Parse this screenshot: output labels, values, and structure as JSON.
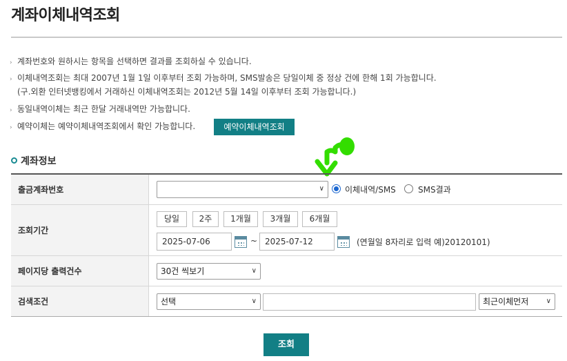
{
  "page": {
    "title": "계좌이체내역조회"
  },
  "notices": [
    "계좌번호와 원하시는 항목을 선택하면 결과를 조회하실 수 있습니다.",
    "이체내역조회는 최대 2007년 1월 1일 이후부터 조회 가능하며, SMS발송은 당일이체 중 정상 건에 한해 1회 가능합니다.",
    "(구.외환 인터넷뱅킹에서 거래하신 이체내역조회는 2012년 5월 14일 이후부터 조회 가능합니다.)",
    "동일내역이체는 최근 한달 거래내역만 가능합니다.",
    "예약이체는 예약이체내역조회에서 확인 가능합니다."
  ],
  "reserve_button": "예약이체내역조회",
  "section": {
    "title": "계좌정보"
  },
  "form": {
    "account": {
      "label": "출금계좌번호",
      "value": "",
      "radio_options": [
        "이체내역/SMS",
        "SMS결과"
      ],
      "selected_radio": "이체내역/SMS"
    },
    "period": {
      "label": "조회기간",
      "quick_buttons": [
        "당일",
        "2주",
        "1개월",
        "3개월",
        "6개월"
      ],
      "start_date": "2025-07-06",
      "separator": "~",
      "end_date": "2025-07-12",
      "hint": "(연월일 8자리로 입력 예)20120101)"
    },
    "page_size": {
      "label": "페이지당 출력건수",
      "selected": "30건 씩보기"
    },
    "search": {
      "label": "검색조건",
      "condition_selected": "선택",
      "keyword_value": "",
      "sort_selected": "최근이체먼저"
    }
  },
  "submit_button": "조회",
  "colors": {
    "accent": "#127f85",
    "annotation_arrow": "#33dd00"
  }
}
